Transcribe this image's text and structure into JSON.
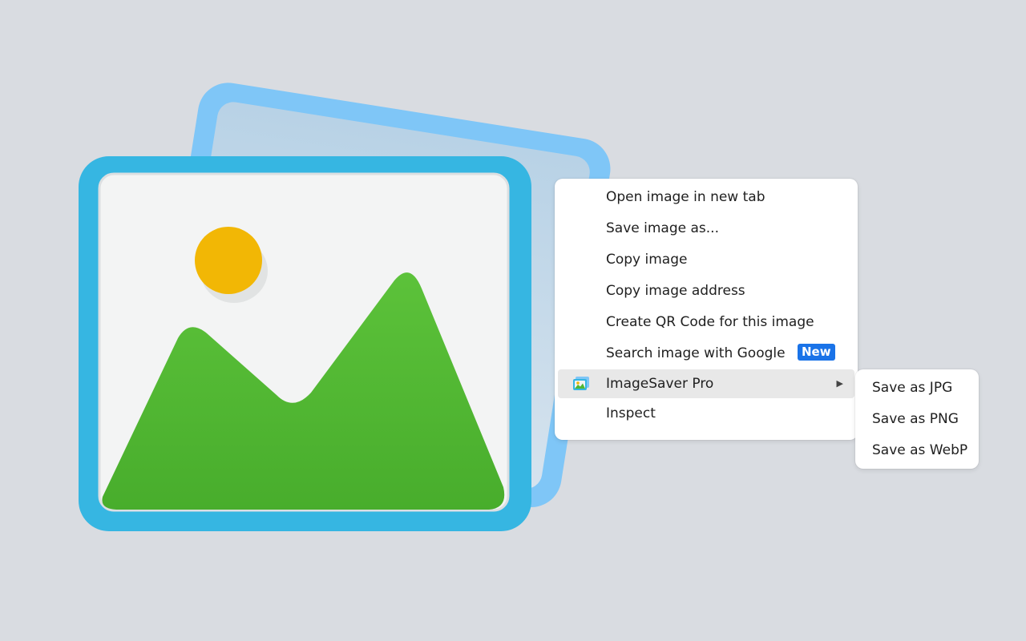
{
  "context_menu": {
    "items": [
      {
        "label": "Open image in new tab"
      },
      {
        "label": "Save image as..."
      },
      {
        "label": "Copy image"
      },
      {
        "label": "Copy image address"
      },
      {
        "label": "Create QR Code for this image"
      },
      {
        "label": "Search image with Google",
        "badge": "New"
      },
      {
        "label": "ImageSaver Pro",
        "icon": "imagesaver-extension-icon",
        "submenu_arrow": "▶"
      },
      {
        "label": "Inspect"
      }
    ]
  },
  "submenu": {
    "items": [
      {
        "label": "Save as JPG"
      },
      {
        "label": "Save as PNG"
      },
      {
        "label": "Save as WebP"
      }
    ]
  },
  "colors": {
    "background": "#d9dce1",
    "badge": "#1a73e8",
    "highlight": "#e8e8e8",
    "frame_front": "#38b8e4",
    "frame_back": "#7fc6f7",
    "sun": "#f2b705",
    "mountain": "#52b733"
  }
}
